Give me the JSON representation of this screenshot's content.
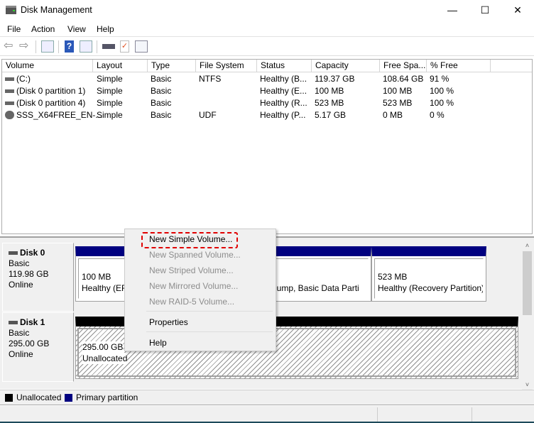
{
  "window": {
    "title": "Disk Management",
    "minimize": "—",
    "maximize": "☐",
    "close": "✕"
  },
  "menu": [
    "File",
    "Action",
    "View",
    "Help"
  ],
  "toolbar": [
    "back-icon",
    "forward-icon",
    "console-tree-icon",
    "help-icon",
    "action-pane-icon",
    "connect-icon",
    "check-icon",
    "properties-icon"
  ],
  "table": {
    "headers": [
      "Volume",
      "Layout",
      "Type",
      "File System",
      "Status",
      "Capacity",
      "Free Spa...",
      "% Free"
    ],
    "rows": [
      {
        "icon": "drive-icon",
        "cells": [
          " (C:)",
          "Simple",
          "Basic",
          "NTFS",
          "Healthy (B...",
          "119.37 GB",
          "108.64 GB",
          "91 %"
        ]
      },
      {
        "icon": "drive-icon",
        "cells": [
          "(Disk 0 partition 1)",
          "Simple",
          "Basic",
          "",
          "Healthy (E...",
          "100 MB",
          "100 MB",
          "100 %"
        ]
      },
      {
        "icon": "drive-icon",
        "cells": [
          "(Disk 0 partition 4)",
          "Simple",
          "Basic",
          "",
          "Healthy (R...",
          "523 MB",
          "523 MB",
          "100 %"
        ]
      },
      {
        "icon": "cd-icon",
        "cells": [
          "SSS_X64FREE_EN-...",
          "Simple",
          "Basic",
          "UDF",
          "Healthy (P...",
          "5.17 GB",
          "0 MB",
          "0 %"
        ]
      }
    ]
  },
  "disks": [
    {
      "name": "Disk 0",
      "type": "Basic",
      "size": "119.98 GB",
      "status": "Online",
      "partitions": [
        {
          "size": "100 MB",
          "status": "Healthy (EF"
        },
        {
          "size": "",
          "status": "n Dump, Basic Data Parti"
        },
        {
          "size": "523 MB",
          "status": "Healthy (Recovery Partition)"
        }
      ]
    },
    {
      "name": "Disk 1",
      "type": "Basic",
      "size": "295.00 GB",
      "status": "Online",
      "partitions": [
        {
          "size": "295.00 GB",
          "status": "Unallocated"
        }
      ]
    }
  ],
  "legend": [
    {
      "label": "Unallocated",
      "color": "#000000"
    },
    {
      "label": "Primary partition",
      "color": "#000080"
    }
  ],
  "context_menu": {
    "items": [
      {
        "label": "New Simple Volume...",
        "enabled": true,
        "highlighted": true
      },
      {
        "label": "New Spanned Volume...",
        "enabled": false
      },
      {
        "label": "New Striped Volume...",
        "enabled": false
      },
      {
        "label": "New Mirrored Volume...",
        "enabled": false
      },
      {
        "label": "New RAID-5 Volume...",
        "enabled": false
      },
      {
        "label": "Properties",
        "enabled": true
      },
      {
        "label": "Help",
        "enabled": true
      }
    ]
  },
  "colors": {
    "primary": "#000080",
    "unallocated": "#000000",
    "highlight": "#e00000"
  }
}
